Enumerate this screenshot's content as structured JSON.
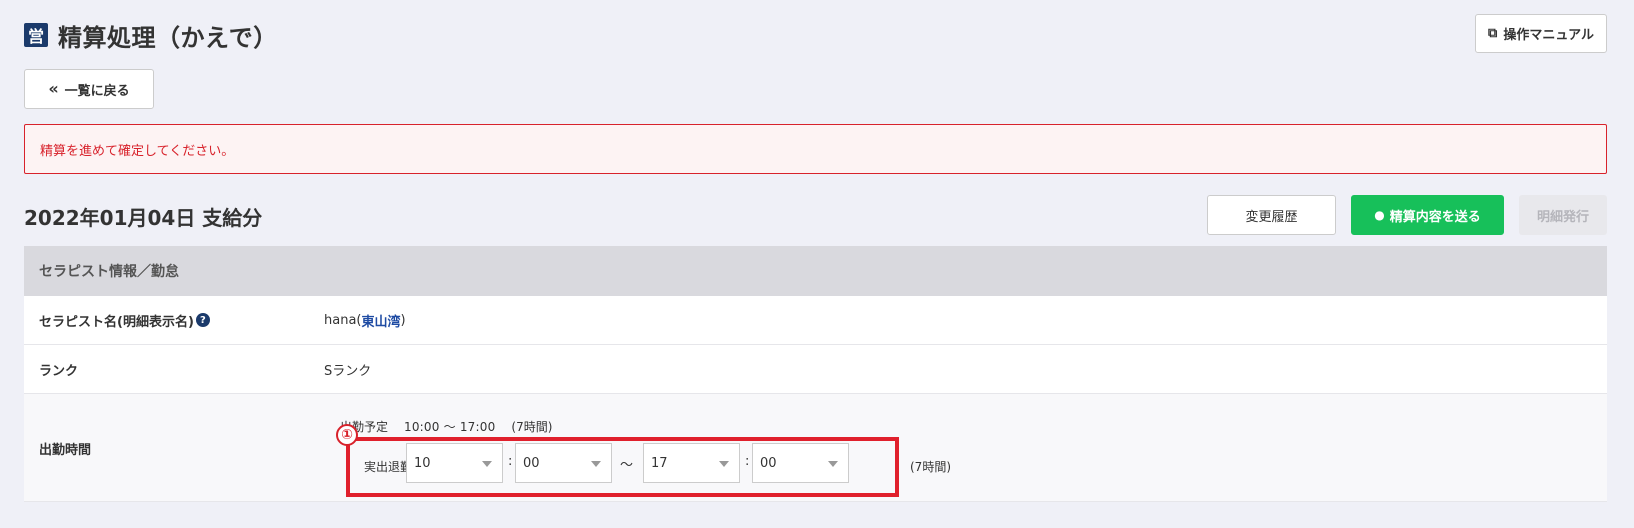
{
  "header": {
    "title_icon": "営",
    "title": "精算処理（かえで）",
    "manual_label": "操作マニュアル"
  },
  "back_label": "一覧に戻る",
  "alert_message": "精算を進めて確定してください。",
  "date_heading": "2022年01月04日 支給分",
  "actions": {
    "history_label": "変更履歴",
    "send_label": "精算内容を送る",
    "issue_label": "明細発行"
  },
  "panel": {
    "title": "セラピスト情報／勤怠",
    "therapist_label": "セラピスト名(明細表示名)",
    "therapist_name": "hana",
    "therapist_store_open": "(",
    "therapist_store": "東山湾",
    "therapist_store_close": ")",
    "rank_label": "ランク",
    "rank_value": "Sランク",
    "time_label": "出勤時間",
    "sched_label": "出勤予定",
    "sched_time": "10:00 〜 17:00",
    "sched_duration": "(7時間)",
    "marker": "①",
    "actual_label": "実出退勤",
    "start_hour": "10",
    "start_min": "00",
    "end_hour": "17",
    "end_min": "00",
    "colon": ":",
    "tilde": "〜",
    "actual_duration": "(7時間)"
  },
  "colors": {
    "accent_green": "#17c05a",
    "alert_red": "#d8222b",
    "brand_navy": "#1b3a6b"
  },
  "icons": {
    "title": "store-icon",
    "manual": "external-link-icon",
    "back": "double-chevron-left-icon",
    "send": "chat-bubble-icon",
    "help": "question-circle-icon"
  }
}
